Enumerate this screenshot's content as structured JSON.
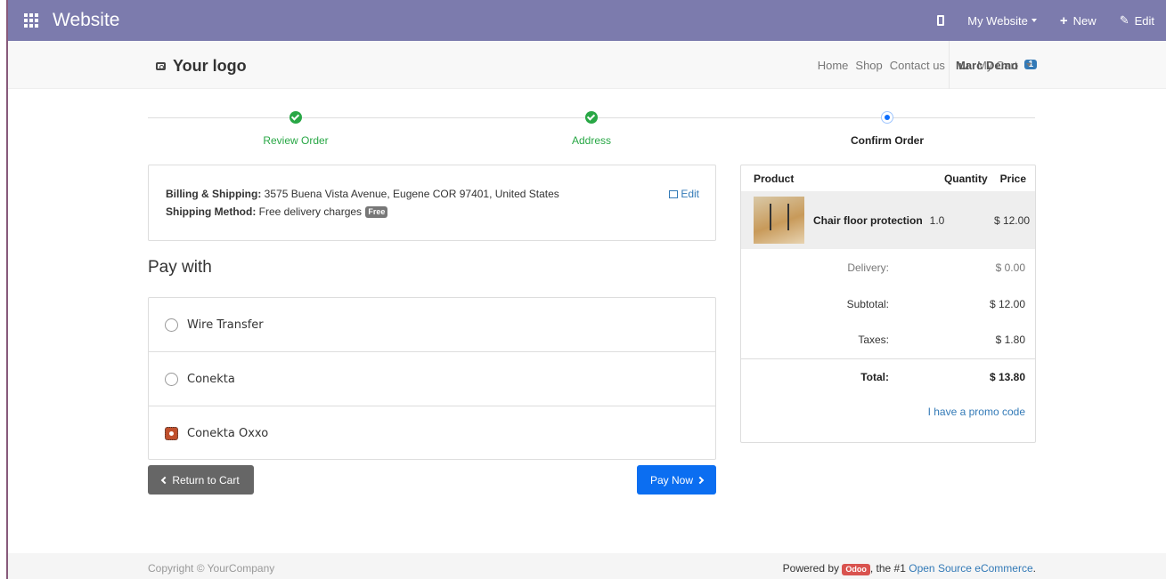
{
  "topbar": {
    "brand": "Website",
    "my_website": "My Website",
    "new_label": "New",
    "edit_label": "Edit"
  },
  "navbar": {
    "logo": "Your logo",
    "menu": [
      "Home",
      "Shop",
      "Contact us"
    ],
    "cart_label": "My Cart",
    "cart_count": "1",
    "user": "Marc Demo"
  },
  "wizard": {
    "steps": [
      {
        "label": "Review Order",
        "state": "done"
      },
      {
        "label": "Address",
        "state": "done"
      },
      {
        "label": "Confirm Order",
        "state": "current"
      }
    ]
  },
  "billing": {
    "billing_label": "Billing & Shipping:",
    "billing_value": "3575 Buena Vista Avenue, Eugene COR 97401, United States",
    "shipping_label": "Shipping Method:",
    "shipping_value": "Free delivery charges",
    "free_badge": "Free",
    "edit_label": "Edit"
  },
  "payment": {
    "title": "Pay with",
    "options": [
      {
        "label": "Wire Transfer",
        "selected": false
      },
      {
        "label": "Conekta",
        "selected": false
      },
      {
        "label": "Conekta Oxxo",
        "selected": true
      }
    ],
    "return_label": "Return to Cart",
    "pay_label": "Pay Now"
  },
  "summary": {
    "headers": {
      "product": "Product",
      "quantity": "Quantity",
      "price": "Price"
    },
    "items": [
      {
        "name": "Chair floor protection",
        "quantity": "1.0",
        "price": "$ 12.00"
      }
    ],
    "delivery_label": "Delivery:",
    "delivery_value": "$ 0.00",
    "subtotal_label": "Subtotal:",
    "subtotal_value": "$ 12.00",
    "taxes_label": "Taxes:",
    "taxes_value": "$ 1.80",
    "total_label": "Total:",
    "total_value": "$ 13.80",
    "promo_label": "I have a promo code"
  },
  "footer": {
    "copyright": "Copyright © YourCompany",
    "powered_prefix": "Powered by",
    "odoo_badge": "Odoo",
    "powered_mid": ", the #1",
    "powered_link": "Open Source eCommerce",
    "powered_suffix": "."
  },
  "colors": {
    "topbar": "#7c7bad",
    "success": "#28a745",
    "primary": "#0b6ef1",
    "link": "#337ab7"
  }
}
